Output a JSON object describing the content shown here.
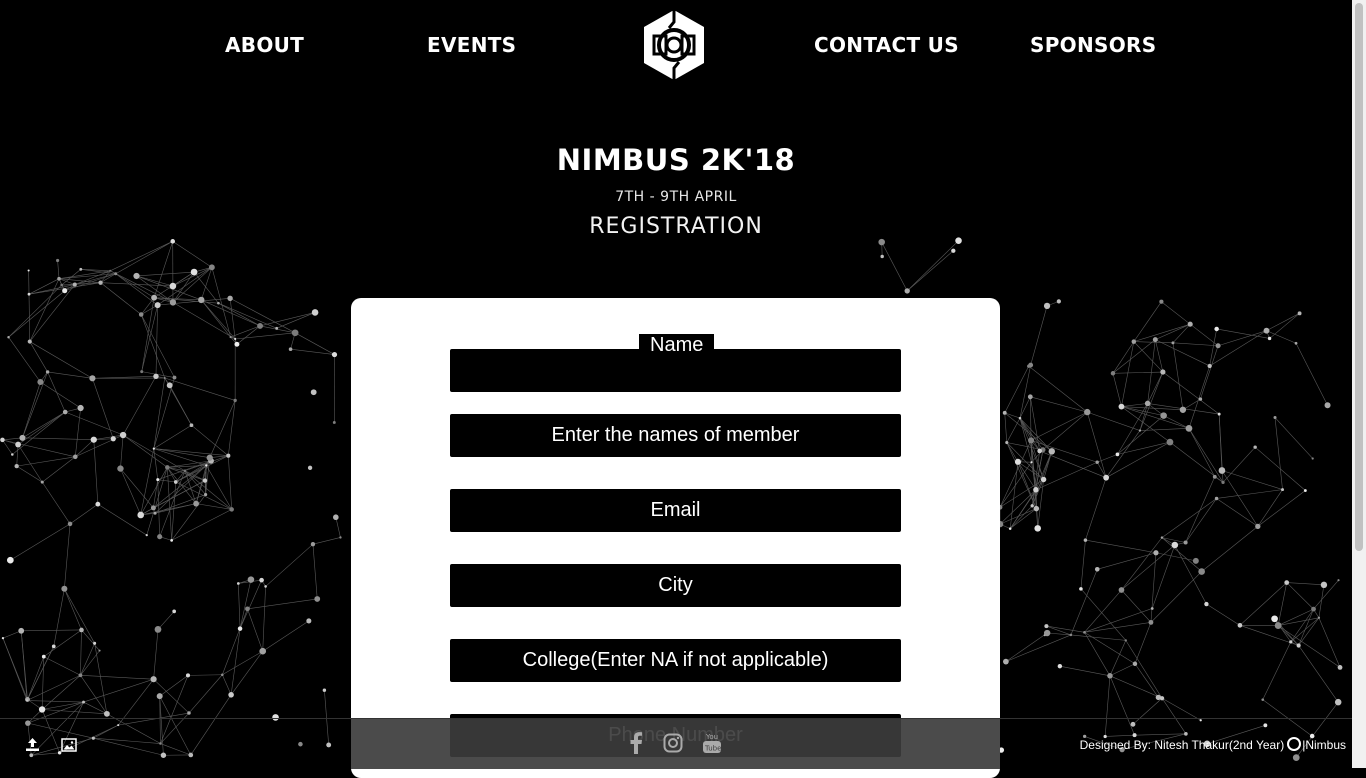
{
  "nav": {
    "items": [
      "ABOUT",
      "EVENTS",
      "CONTACT US",
      "SPONSORS"
    ]
  },
  "header": {
    "title": "NIMBUS 2K'18",
    "dates": "7TH - 9TH APRIL",
    "subtitle": "REGISTRATION"
  },
  "form": {
    "name_label": "Name",
    "name_value": "",
    "members_placeholder": "Enter the names of member",
    "email_placeholder": "Email",
    "city_placeholder": "City",
    "college_placeholder": "College(Enter NA if not applicable)",
    "phone_placeholder": "Phone Number"
  },
  "footer": {
    "credit": "Designed By: Nitesh Thakur(2nd Year)",
    "credit_brand": "|Nimbus",
    "social_icons": [
      "facebook-icon",
      "instagram-icon",
      "youtube-icon"
    ],
    "tool_icons": [
      "upload-icon",
      "image-icon"
    ]
  },
  "colors": {
    "background": "#000000",
    "card": "#ffffff",
    "field": "#000000",
    "text": "#ffffff"
  }
}
